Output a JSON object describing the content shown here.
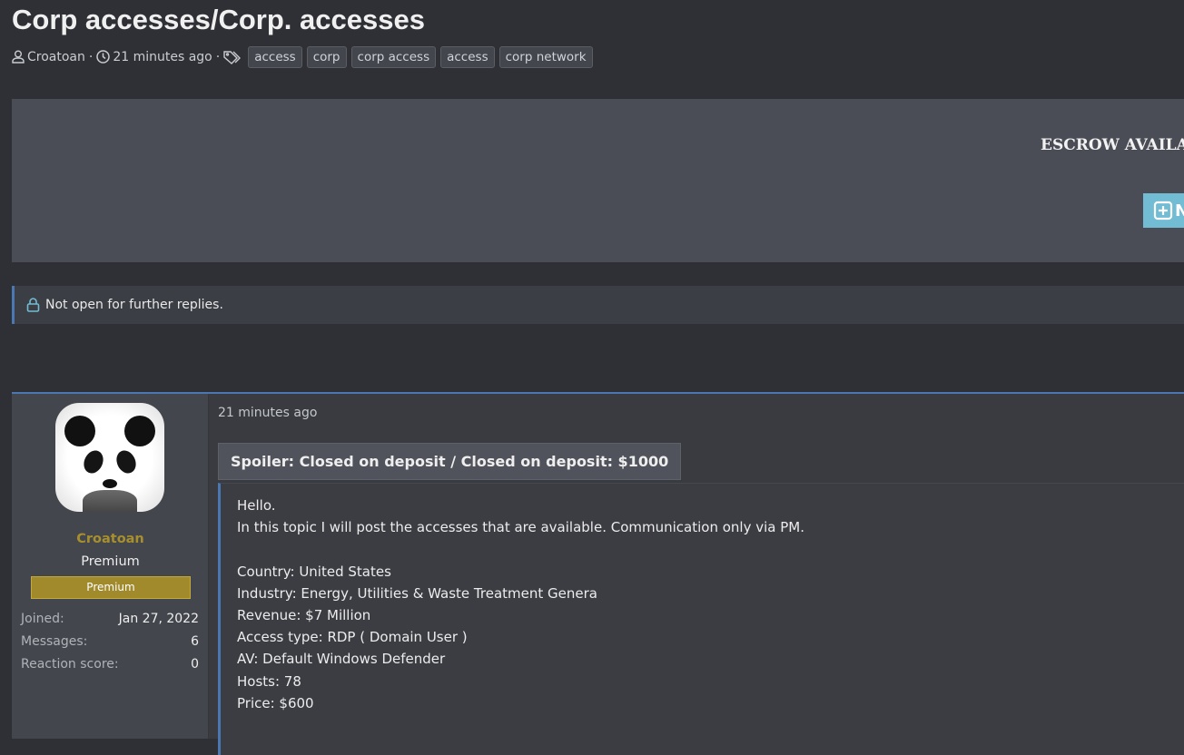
{
  "thread": {
    "title": "Corp accesses/Corp. accesses",
    "author": "Croatoan",
    "time": "21 minutes ago",
    "tags": [
      "access",
      "corp",
      "corp access",
      "access",
      "corp network"
    ]
  },
  "banner": {
    "text": "ESCROW AVAILA",
    "button_label": "N"
  },
  "notice": "Not open for further replies.",
  "post": {
    "user": {
      "name": "Croatoan",
      "title": "Premium",
      "badge": "Premium",
      "stats": [
        {
          "k": "Joined:",
          "v": "Jan 27, 2022"
        },
        {
          "k": "Messages:",
          "v": "6"
        },
        {
          "k": "Reaction score:",
          "v": "0"
        }
      ]
    },
    "time": "21 minutes ago",
    "spoiler_title": "Spoiler: Closed on deposit / Closed on deposit: $1000",
    "lines": [
      "Hello.",
      "In this topic I will post the accesses that are available. Communication only via PM.",
      "",
      "Country: United States",
      "Industry: Energy, Utilities & Waste Treatment Genera",
      "Revenue: $7 Million",
      "Access type: RDP ( Domain User )",
      "AV: Default Windows Defender",
      "Hosts: 78",
      "Price: $600"
    ]
  },
  "colors": {
    "accent": "#4b78b3",
    "username": "#a88f2e",
    "badge": "#a08a2b",
    "button": "#72bcd4"
  }
}
